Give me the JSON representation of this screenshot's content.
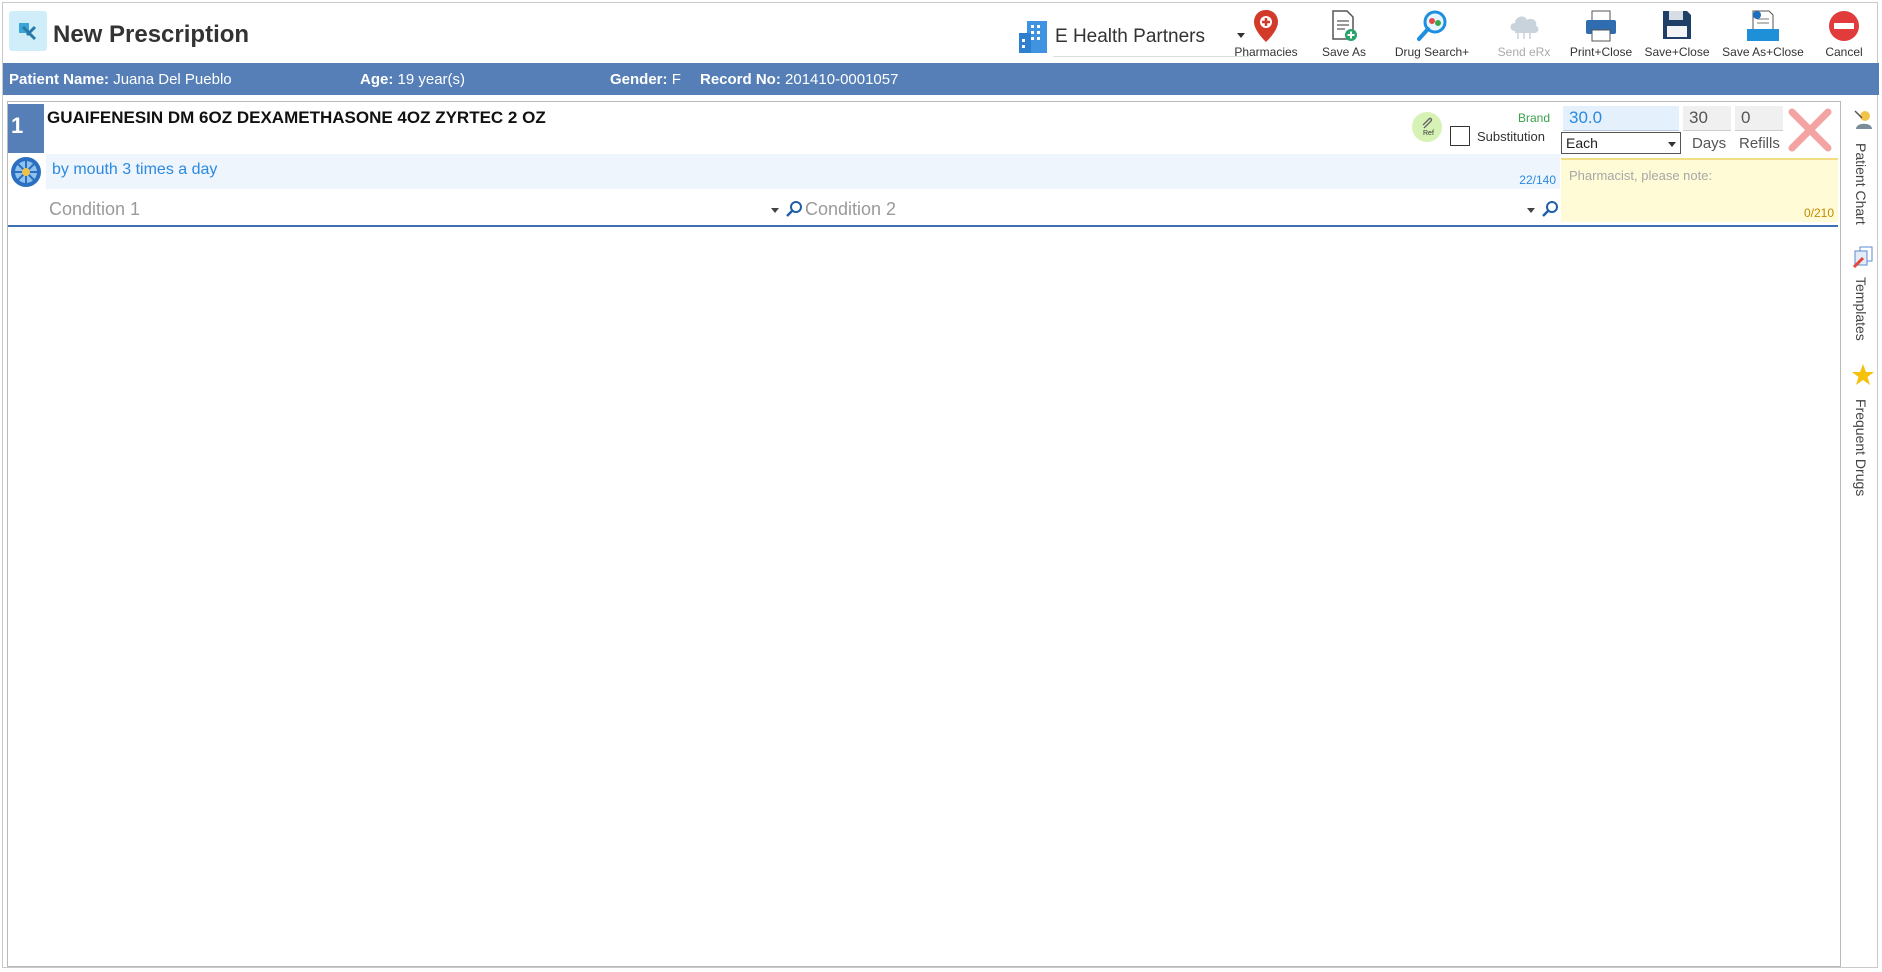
{
  "window": {
    "title": "New Prescription"
  },
  "clinic": {
    "name": "E Health Partners"
  },
  "toolbar": {
    "pharmacies": "Pharmacies",
    "save_as": "Save As",
    "drug_search": "Drug Search+",
    "send_erx": "Send eRx",
    "print_close": "Print+Close",
    "save_close": "Save+Close",
    "save_as_close": "Save As+Close",
    "cancel": "Cancel"
  },
  "patient": {
    "name_label": "Patient Name:",
    "name": "Juana Del Pueblo",
    "age_label": "Age:",
    "age": "19 year(s)",
    "gender_label": "Gender:",
    "gender": "F",
    "record_label": "Record No:",
    "record": "201410-0001057"
  },
  "prescription": {
    "number": "1",
    "drug": "GUAIFENESIN DM 6OZ  DEXAMETHASONE 4OZ  ZYRTEC 2 OZ",
    "sig": "by mouth 3 times a day",
    "sig_count": "22/140",
    "condition1_placeholder": "Condition 1",
    "condition2_placeholder": "Condition 2",
    "ref_label": "Ref",
    "brand_label": "Brand",
    "substitution_label": "Substitution",
    "quantity": "30.0",
    "unit": "Each",
    "days": "30",
    "days_label": "Days",
    "refills": "0",
    "refills_label": "Refills",
    "pharmacist_note_placeholder": "Pharmacist, please note:",
    "pharmacist_note_count": "0/210"
  },
  "sidebar": {
    "patient_chart": "Patient Chart",
    "templates": "Templates",
    "frequent_drugs": "Frequent Drugs"
  }
}
